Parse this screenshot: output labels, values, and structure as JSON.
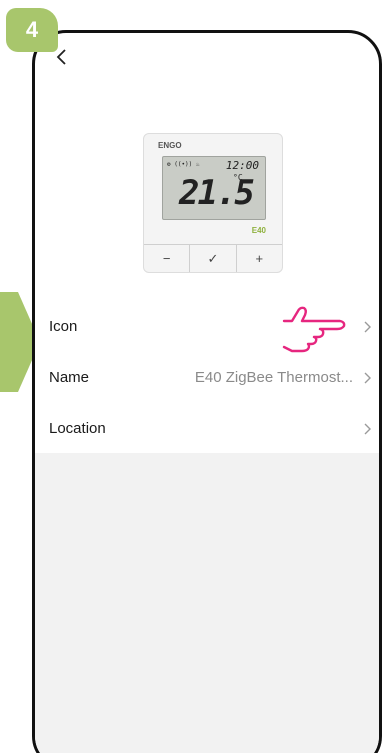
{
  "step": {
    "number": "4"
  },
  "device": {
    "brand": "ENGO",
    "clock": "12:00",
    "temperature": "21.5",
    "unit": "°C",
    "model": "E40",
    "buttons": [
      "−",
      "✓",
      "+"
    ]
  },
  "settings": [
    {
      "label": "Icon",
      "value": ""
    },
    {
      "label": "Name",
      "value": "E40 ZigBee Thermost..."
    },
    {
      "label": "Location",
      "value": ""
    }
  ],
  "colors": {
    "accent": "#a8c66c",
    "pointer": "#e6267f"
  },
  "icons": {
    "back": "chevron-left-icon",
    "row": "chevron-right-icon",
    "pointer": "pointing-hand-icon"
  }
}
